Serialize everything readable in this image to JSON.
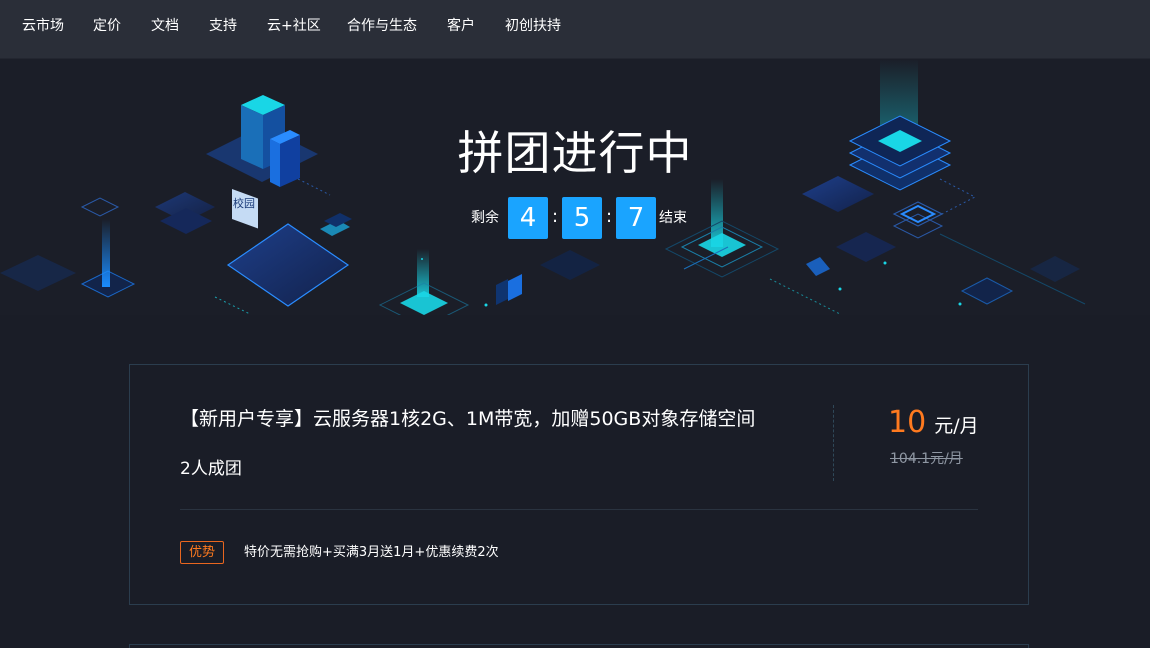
{
  "nav": {
    "items": [
      "云市场",
      "定价",
      "文档",
      "支持",
      "云+社区",
      "合作与生态",
      "客户",
      "初创扶持"
    ]
  },
  "hero": {
    "title": "拼团进行中",
    "remaining_label": "剩余",
    "end_label": "结束",
    "digits": [
      "4",
      "5",
      "7"
    ],
    "colon": ":",
    "campus_badge": "校园"
  },
  "card": {
    "title": "【新用户专享】云服务器1核2G、1M带宽，加赠50GB对象存储空间",
    "group_size": "2人成团",
    "price_value": "10",
    "price_unit": "元/月",
    "original_price": "104.1元/月",
    "tag": "优势",
    "tag_description": "特价无需抢购+买满3月送1月+优惠续费2次"
  },
  "colors": {
    "accent_blue": "#1aa4ff",
    "price_orange": "#ff7a1f",
    "background": "#1a1d27",
    "nav_background": "#2a2e38"
  }
}
